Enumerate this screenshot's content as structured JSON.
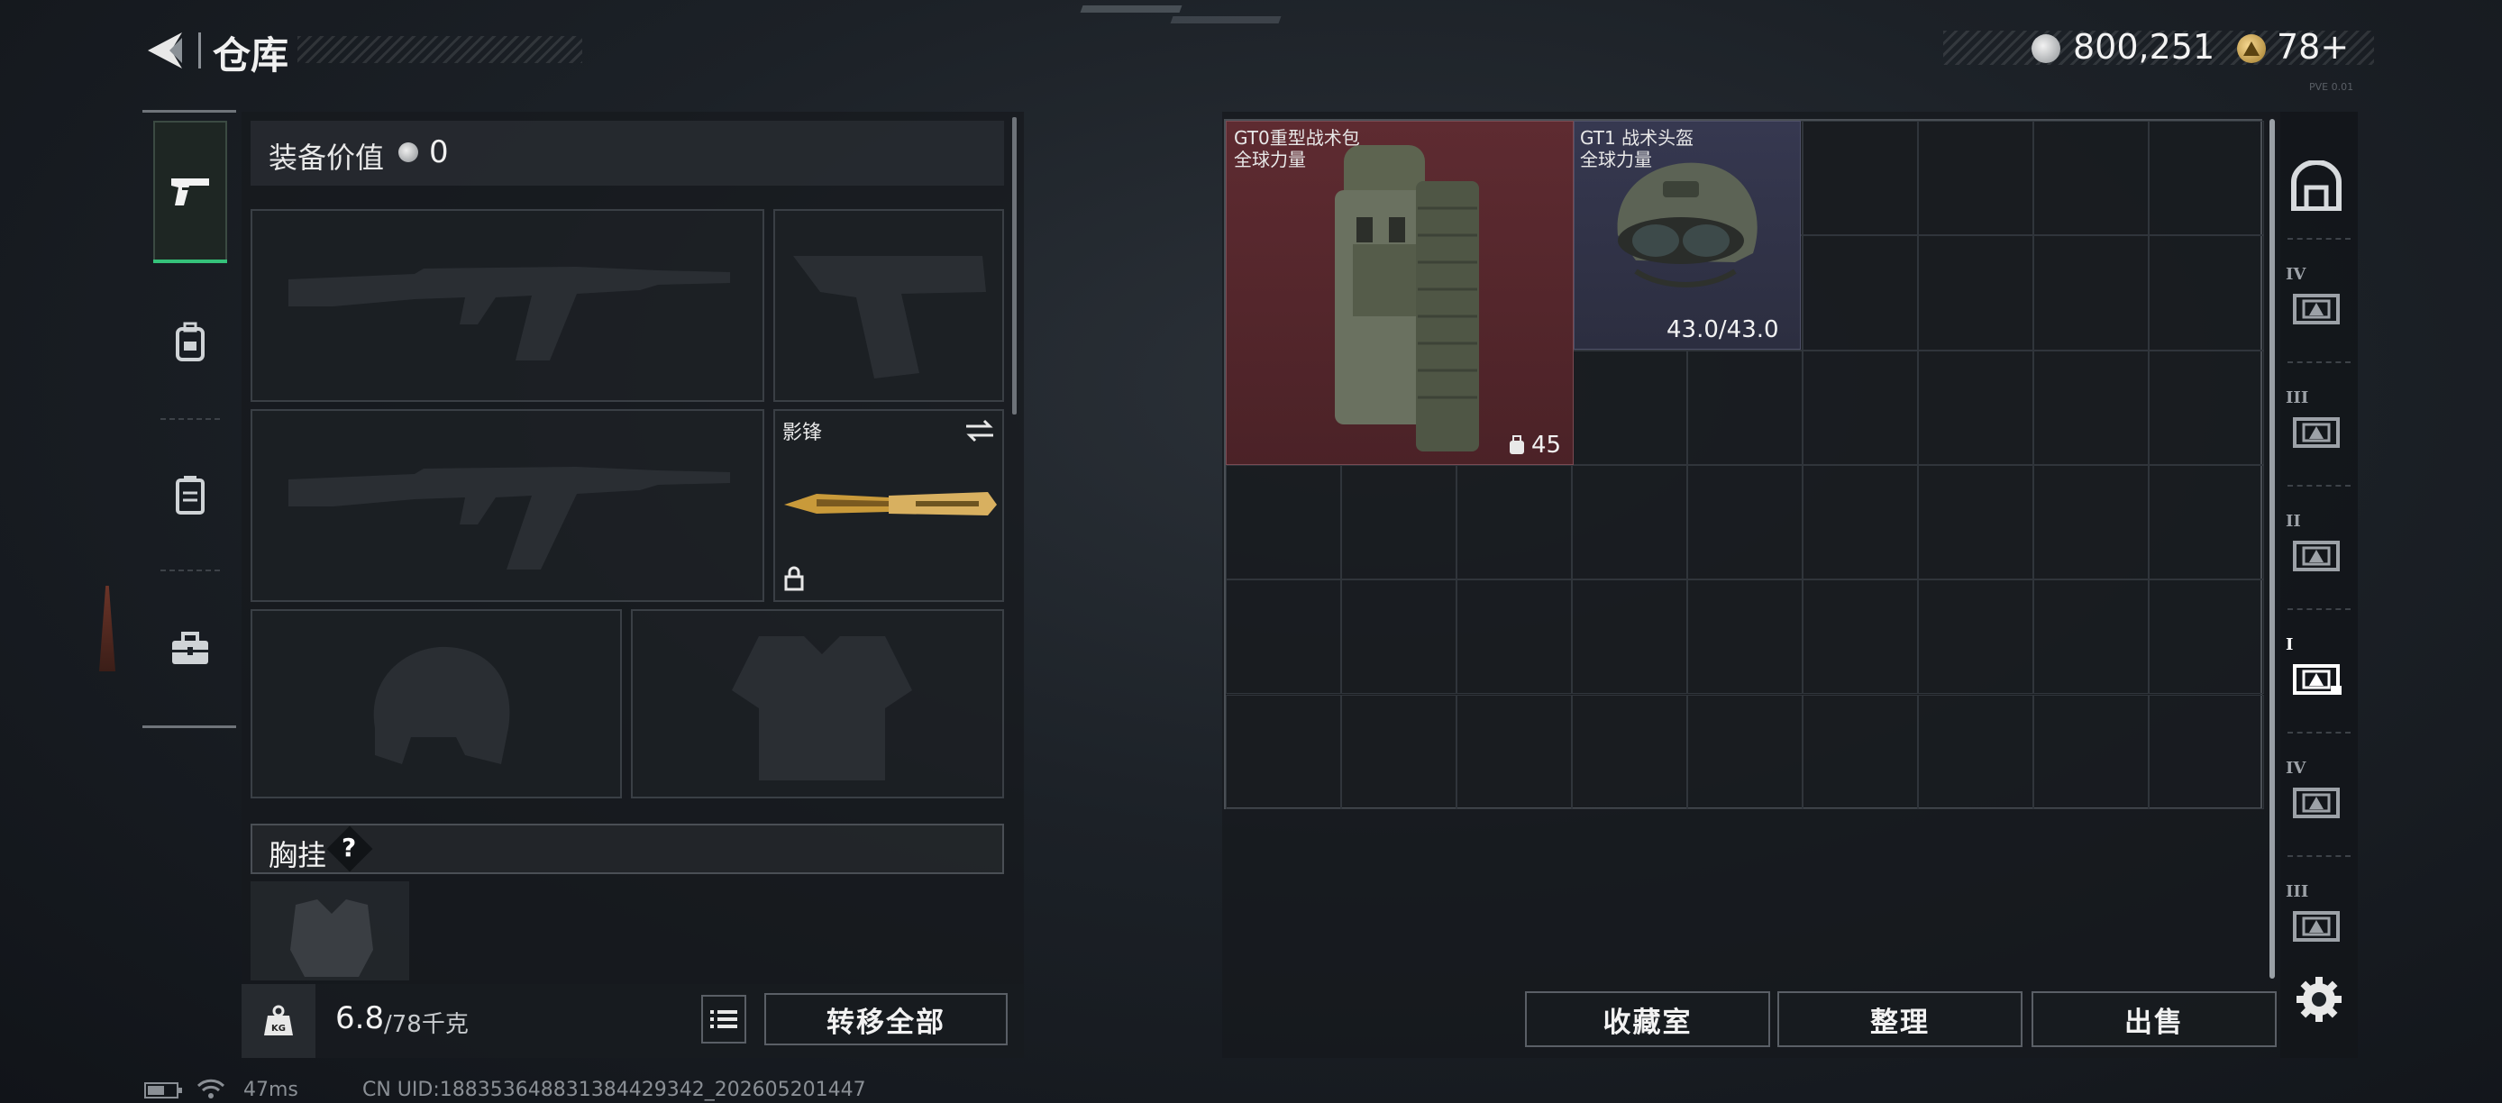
{
  "header": {
    "back_icon": "back-arrow-icon",
    "title": "仓库",
    "currency_icon": "silver-coin-icon",
    "currency": "800,251",
    "premium_icon": "gold-triangle-coin-icon",
    "premium": "78+",
    "version": "PVE 0.01"
  },
  "left_tabs": [
    {
      "icon": "pistol-icon",
      "active": true
    },
    {
      "icon": "backpack-icon",
      "active": false
    },
    {
      "icon": "container-icon",
      "active": false
    },
    {
      "icon": "toolbox-icon",
      "active": false
    }
  ],
  "equipment": {
    "value_label": "装备价值",
    "value_icon": "coin-icon",
    "value": "0",
    "melee_label": "影锋",
    "chest_label": "胸挂",
    "chest_help": "?",
    "weight": "6.8",
    "weight_capacity": "/78千克",
    "transfer_all": "转移全部"
  },
  "storage": {
    "items": [
      {
        "name": "GT0重型战术包",
        "subtitle": "全球力量",
        "count": "45",
        "count_icon": "bag-icon",
        "color": "#5a2a30"
      },
      {
        "name": "GT1 战术头盔",
        "subtitle": "全球力量",
        "durability": "43.0/43.0",
        "color": "#33354a"
      }
    ],
    "buttons": {
      "collection": "收藏室",
      "organize": "整理",
      "sell": "出售"
    }
  },
  "right_tabs": [
    {
      "icon": "vault-icon",
      "label": ""
    },
    {
      "icon": "storage-box-icon",
      "label": "IV"
    },
    {
      "icon": "storage-box-icon",
      "label": "III"
    },
    {
      "icon": "storage-box-icon",
      "label": "II"
    },
    {
      "icon": "storage-box-icon",
      "label": "I",
      "active": true
    },
    {
      "icon": "storage-box-icon",
      "label": "IV"
    },
    {
      "icon": "storage-box-icon",
      "label": "III"
    },
    {
      "icon": "settings-gear-icon",
      "label": ""
    }
  ],
  "status_bar": {
    "ping": "47ms",
    "uid": "CN UID:188353648831384429342_202605201447"
  }
}
